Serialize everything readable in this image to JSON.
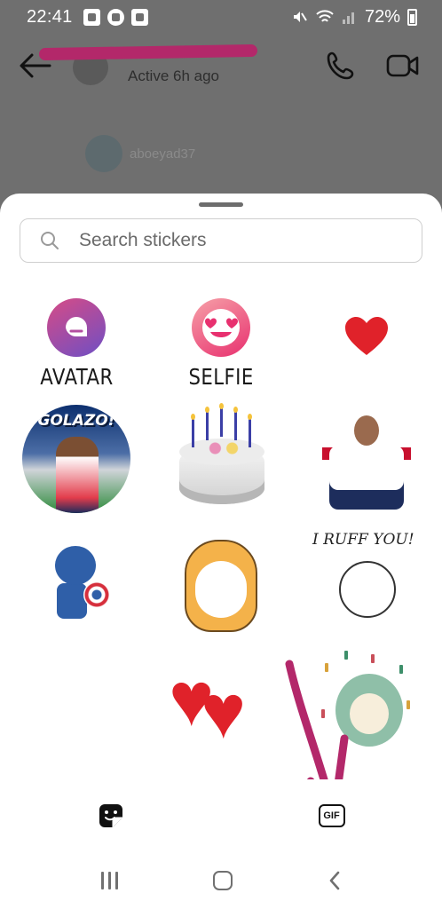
{
  "status_bar": {
    "time": "22:41",
    "battery": "72%",
    "left_icons": [
      "gallery-icon",
      "music-icon",
      "media-icon"
    ],
    "right_icons": [
      "mute-icon",
      "wifi-icon",
      "signal-icon",
      "battery-icon"
    ]
  },
  "chat": {
    "active_status": "Active 6h ago",
    "user_handle": "aboeyad37"
  },
  "sticker_panel": {
    "search_placeholder": "Search stickers",
    "special_tiles": [
      {
        "label": "AVATAR",
        "icon": "avatar-sticker-icon"
      },
      {
        "label": "SELFIE",
        "icon": "selfie-sticker-icon"
      },
      {
        "label": "",
        "icon": "heart-sticker-icon"
      }
    ],
    "sticker_texts": {
      "golazo": "GOLAZO!",
      "ruff": "I RUFF YOU!"
    },
    "tabs": [
      {
        "icon": "sticker-tab-icon"
      },
      {
        "icon": "gif-tab-icon",
        "label": "GIF"
      }
    ]
  },
  "colors": {
    "annotation": "#b3286a",
    "heart": "#e0222a"
  },
  "system_nav": [
    "recents-button",
    "home-button",
    "back-button"
  ]
}
